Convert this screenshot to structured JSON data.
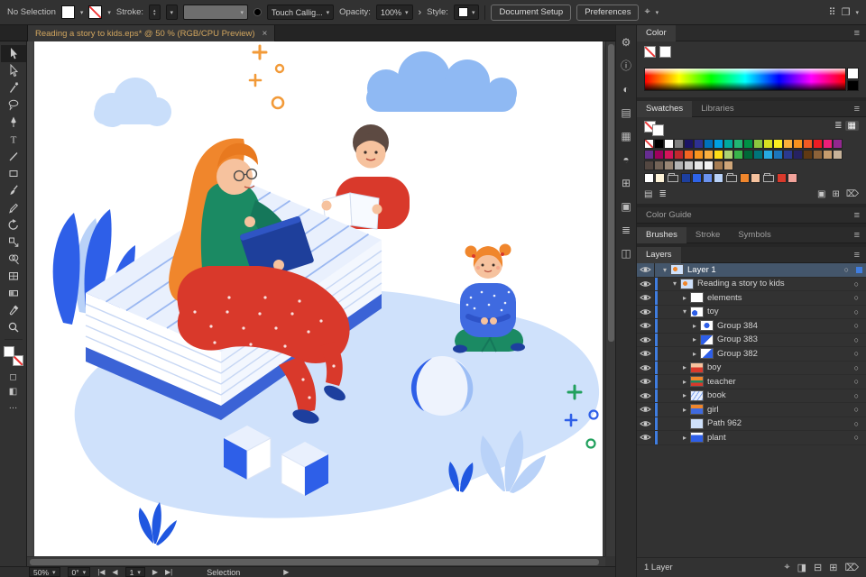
{
  "topbar": {
    "no_selection": "No Selection",
    "stroke_label": "Stroke:",
    "brush_value": "Touch Callig...",
    "opacity_label": "Opacity:",
    "opacity_value": "100%",
    "style_label": "Style:",
    "document_setup": "Document Setup",
    "preferences": "Preferences"
  },
  "tab": {
    "title": "Reading a story to kids.eps* @ 50 % (RGB/CPU Preview)",
    "close": "×"
  },
  "tools": {
    "items": [
      {
        "name": "selection",
        "active": true
      },
      {
        "name": "direct-selection",
        "active": false
      },
      {
        "name": "magic-wand",
        "active": false
      },
      {
        "name": "lasso",
        "active": false
      },
      {
        "name": "pen",
        "active": false
      },
      {
        "name": "type",
        "active": false
      },
      {
        "name": "line-segment",
        "active": false
      },
      {
        "name": "rectangle",
        "active": false
      },
      {
        "name": "paintbrush",
        "active": false
      },
      {
        "name": "pencil",
        "active": false
      },
      {
        "name": "rotate",
        "active": false
      },
      {
        "name": "scale",
        "active": false
      },
      {
        "name": "shape-builder",
        "active": false
      },
      {
        "name": "mesh",
        "active": false
      },
      {
        "name": "gradient",
        "active": false
      },
      {
        "name": "eyedropper",
        "active": false
      },
      {
        "name": "zoom",
        "active": false
      }
    ]
  },
  "dock": {
    "items": [
      "properties",
      "info",
      "color",
      "swatches",
      "gradient",
      "transparency",
      "transform",
      "artboards",
      "appearance",
      "asset-export"
    ]
  },
  "panels": {
    "color": {
      "title": "Color"
    },
    "swatches": {
      "tabs": [
        {
          "label": "Swatches",
          "active": true
        },
        {
          "label": "Libraries",
          "active": false
        }
      ],
      "rows": [
        [
          "none",
          "#000000",
          "#ffffff",
          "#808080",
          "#1b1464",
          "#2e3192",
          "#0071bc",
          "#00a0e3",
          "#00a99d",
          "#22b573",
          "#009245",
          "#8cc63f",
          "#d9e021",
          "#fcee21",
          "#fbb03b",
          "#f7931e",
          "#f15a24",
          "#ed1c24",
          "#ed1e79",
          "#93278f"
        ],
        [
          "#662d91",
          "#9e005d",
          "#d4145a",
          "#c1272d",
          "#f26522",
          "#f7941e",
          "#fbb040",
          "#ffde17",
          "#acd373",
          "#39b54a",
          "#006838",
          "#00747a",
          "#27aae1",
          "#1c75bc",
          "#2b3990",
          "#262262",
          "#603913",
          "#8c6239",
          "#c69c6d",
          "#c7b299"
        ],
        [
          "#534741",
          "#736357",
          "#998675",
          "#b3b3b3",
          "#cccccc",
          "#e6e6e6",
          "#f2f2f2",
          "#a67c52",
          "#d0a679"
        ]
      ],
      "groups": [
        {
          "t": "s",
          "c": "#ffffff"
        },
        {
          "t": "s",
          "c": "#fdf3d8"
        },
        {
          "t": "f"
        },
        {
          "t": "s",
          "c": "#1d3f9e"
        },
        {
          "t": "s",
          "c": "#2e63e8"
        },
        {
          "t": "s",
          "c": "#6b93f0"
        },
        {
          "t": "s",
          "c": "#b9d2f8"
        },
        {
          "t": "f"
        },
        {
          "t": "s",
          "c": "#f0862c"
        },
        {
          "t": "s",
          "c": "#f6c29e"
        },
        {
          "t": "f"
        },
        {
          "t": "s",
          "c": "#d9392b"
        },
        {
          "t": "s",
          "c": "#f2a39b"
        }
      ]
    },
    "color_guide": {
      "title": "Color Guide"
    },
    "brushes": {
      "tabs": [
        {
          "label": "Brushes",
          "active": true
        },
        {
          "label": "Stroke",
          "active": false
        },
        {
          "label": "Symbols",
          "active": false
        }
      ]
    },
    "layers": {
      "title": "Layers",
      "footer": "1 Layer",
      "rows": [
        {
          "name": "Layer 1",
          "depth": 0,
          "chevron": "down",
          "thumb": "scene",
          "selected": true
        },
        {
          "name": "Reading a story to kids",
          "depth": 1,
          "chevron": "down",
          "thumb": "scene",
          "selected": false
        },
        {
          "name": "elements",
          "depth": 2,
          "chevron": "right",
          "thumb": "white",
          "selected": false
        },
        {
          "name": "toy",
          "depth": 2,
          "chevron": "down",
          "thumb": "toy",
          "selected": false
        },
        {
          "name": "Group 384",
          "depth": 3,
          "chevron": "right",
          "thumb": "ball",
          "selected": false
        },
        {
          "name": "Group 383",
          "depth": 3,
          "chevron": "right",
          "thumb": "cube-blue",
          "selected": false
        },
        {
          "name": "Group 382",
          "depth": 3,
          "chevron": "right",
          "thumb": "cube-white",
          "selected": false
        },
        {
          "name": "boy",
          "depth": 2,
          "chevron": "right",
          "thumb": "boy",
          "selected": false
        },
        {
          "name": "teacher",
          "depth": 2,
          "chevron": "right",
          "thumb": "teacher",
          "selected": false
        },
        {
          "name": "book",
          "depth": 2,
          "chevron": "right",
          "thumb": "book",
          "selected": false
        },
        {
          "name": "girl",
          "depth": 2,
          "chevron": "right",
          "thumb": "girl",
          "selected": false
        },
        {
          "name": "Path 962",
          "depth": 2,
          "chevron": "none",
          "thumb": "blob",
          "selected": false
        },
        {
          "name": "plant",
          "depth": 2,
          "chevron": "right",
          "thumb": "plant",
          "selected": false
        }
      ]
    }
  },
  "statusbar": {
    "zoom": "50%",
    "rotation": "0°",
    "artboard_number": "1",
    "hint": "Selection"
  },
  "colors": {
    "accent": "#3f7de0",
    "selection_row": "#44566b"
  }
}
